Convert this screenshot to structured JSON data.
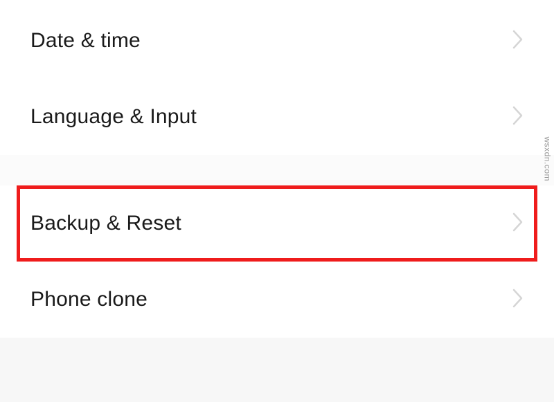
{
  "settings": {
    "items": [
      {
        "label": "Date & time"
      },
      {
        "label": "Language & Input"
      },
      {
        "label": "Backup & Reset"
      },
      {
        "label": "Phone clone"
      }
    ]
  },
  "watermark": "wsxdn.com",
  "colors": {
    "highlight": "#ef1c1c"
  }
}
